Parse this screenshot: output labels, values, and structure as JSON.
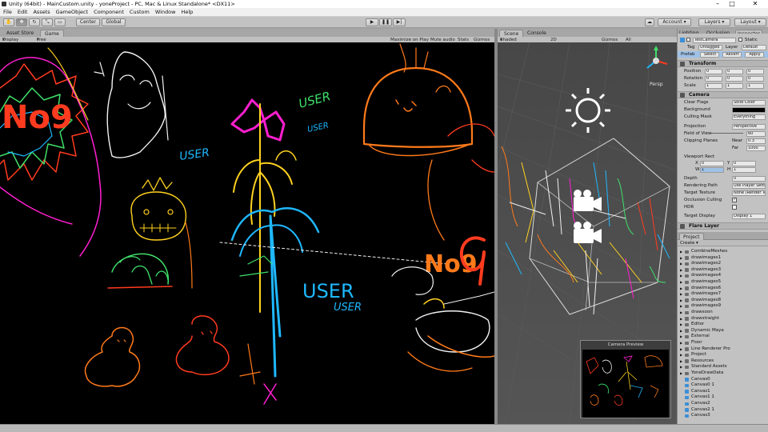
{
  "window": {
    "title": "Unity (64bit) - MainCustom.unity - yoneProject - PC, Mac & Linux Standalone* <DX11>",
    "minimize": "–",
    "maximize": "□",
    "close": "✕"
  },
  "menu": [
    "File",
    "Edit",
    "Assets",
    "GameObject",
    "Component",
    "Custom",
    "Window",
    "Help"
  ],
  "toolbar": {
    "center_label": "Center",
    "global_label": "Global",
    "account_label": "Account",
    "layers_label": "Layers",
    "layout_label": "Layout"
  },
  "left_tabs": [
    "Asset Store",
    "Game"
  ],
  "game_bar": {
    "display": "Display 1",
    "aspect": "Free Aspect",
    "maximize_on_play": "Maximize on Play",
    "mute_audio": "Mute audio",
    "stats": "Stats",
    "gizmos": "Gizmos"
  },
  "scene_tabs": [
    "Scene",
    "Console"
  ],
  "scene_bar": {
    "shaded": "Shaded",
    "mode_2d": "2D",
    "gizmos": "Gizmos",
    "search": "All"
  },
  "scene_gizmo": {
    "persp": "Persp"
  },
  "camera_preview": {
    "title": "Camera Preview"
  },
  "inspector": {
    "tabs": [
      "Lighting",
      "Occlusion",
      "Inspector"
    ],
    "object_name": "TestCamera",
    "static_label": "Static",
    "tag_label": "Tag",
    "tag_value": "Untagged",
    "layer_label": "Layer",
    "layer_value": "Default",
    "prefab_label": "Prefab",
    "prefab_buttons": [
      "Select",
      "Revert",
      "Apply"
    ],
    "transform": {
      "title": "Transform",
      "rows": [
        {
          "label": "Position",
          "x": "0",
          "y": "0",
          "z": "0"
        },
        {
          "label": "Rotation",
          "x": "0",
          "y": "0",
          "z": "0"
        },
        {
          "label": "Scale",
          "x": "1",
          "y": "1",
          "z": "1"
        }
      ]
    },
    "camera": {
      "title": "Camera",
      "clear_flags_label": "Clear Flags",
      "clear_flags_value": "Solid Color",
      "background_label": "Background",
      "culling_mask_label": "Culling Mask",
      "culling_mask_value": "Everything",
      "projection_label": "Projection",
      "projection_value": "Perspective",
      "fov_label": "Field of View",
      "fov_value": "60",
      "clipping_label": "Clipping Planes",
      "near_label": "Near",
      "near_value": "0.3",
      "far_label": "Far",
      "far_value": "1000",
      "viewport_label": "Viewport Rect",
      "vp_x_label": "X",
      "vp_x_value": "0",
      "vp_y_label": "Y",
      "vp_y_value": "0",
      "vp_w_label": "W",
      "vp_w_value": "1",
      "vp_h_label": "H",
      "vp_h_value": "1",
      "depth_label": "Depth",
      "depth_value": "0",
      "rendering_path_label": "Rendering Path",
      "rendering_path_value": "Use Player Settings",
      "target_texture_label": "Target Texture",
      "target_texture_value": "None (Render Texture)",
      "occlusion_label": "Occlusion Culling",
      "hdr_label": "HDR",
      "target_display_label": "Target Display",
      "target_display_value": "Display 1"
    },
    "flare_layer": "Flare Layer"
  },
  "project": {
    "tab": "Project",
    "create": "Create",
    "items": [
      {
        "name": "CombineMeshes",
        "type": "folder"
      },
      {
        "name": "drawimages1",
        "type": "folder"
      },
      {
        "name": "drawimages2",
        "type": "folder"
      },
      {
        "name": "drawimages3",
        "type": "folder"
      },
      {
        "name": "drawimages4",
        "type": "folder"
      },
      {
        "name": "drawimages5",
        "type": "folder"
      },
      {
        "name": "drawimages6",
        "type": "folder"
      },
      {
        "name": "drawimages7",
        "type": "folder"
      },
      {
        "name": "drawimages8",
        "type": "folder"
      },
      {
        "name": "drawimages9",
        "type": "folder"
      },
      {
        "name": "drawsoon",
        "type": "folder"
      },
      {
        "name": "drawstraight",
        "type": "folder"
      },
      {
        "name": "Editor",
        "type": "folder"
      },
      {
        "name": "Dynamic Maya",
        "type": "folder"
      },
      {
        "name": "External",
        "type": "folder"
      },
      {
        "name": "Floor",
        "type": "folder"
      },
      {
        "name": "Line Renderer Pro",
        "type": "folder"
      },
      {
        "name": "Project",
        "type": "folder"
      },
      {
        "name": "Resources",
        "type": "folder"
      },
      {
        "name": "Standard Assets",
        "type": "folder"
      },
      {
        "name": "YoneDrawData",
        "type": "folder"
      },
      {
        "name": "Canvas0",
        "type": "asset"
      },
      {
        "name": "Canvas0 1",
        "type": "asset"
      },
      {
        "name": "Canvas1",
        "type": "asset"
      },
      {
        "name": "Canvas1 1",
        "type": "asset"
      },
      {
        "name": "Canvas2",
        "type": "asset"
      },
      {
        "name": "Canvas2 1",
        "type": "asset"
      },
      {
        "name": "Canvas3",
        "type": "asset"
      }
    ]
  },
  "drawing_text": {
    "no9_left": "No9",
    "user_1": "USER",
    "user_2": "USER",
    "user_3": "USER",
    "user_main": "USER",
    "user_small": "USER",
    "no9_right": "No9"
  },
  "colors": {
    "play_bar": "#c2c2c2",
    "game_bg": "#000000",
    "scene_bg": "#4b4b4b",
    "orange": "#ff7a1a",
    "red": "#ff3b1f",
    "magenta": "#ff1fd0",
    "yellow": "#ffd21f",
    "cyan": "#1fb8ff",
    "green": "#3fe06a",
    "white": "#f2f2f2"
  }
}
